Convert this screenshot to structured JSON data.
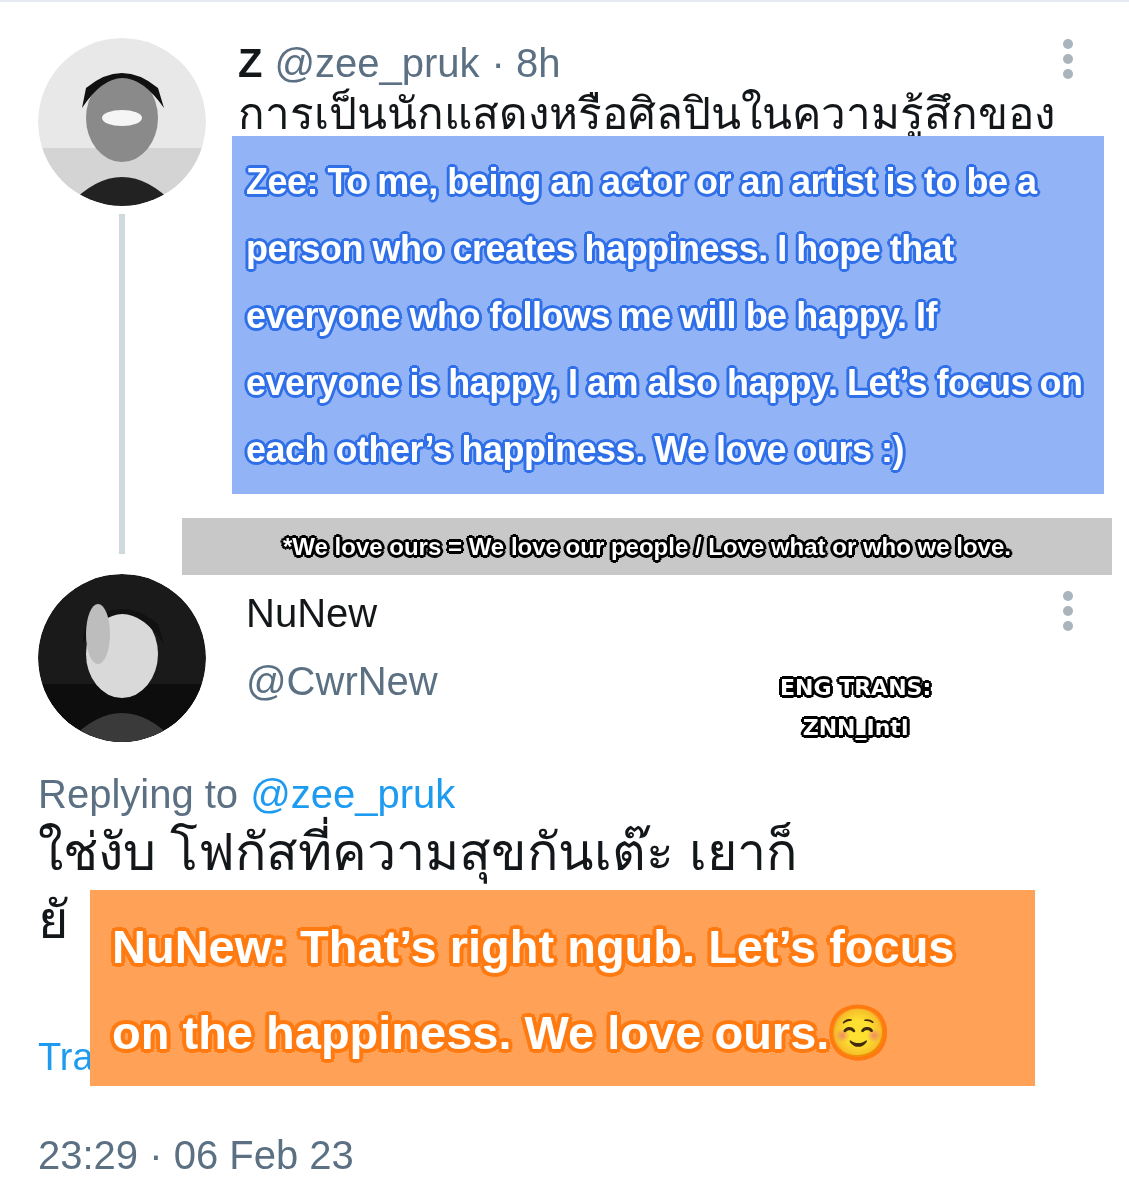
{
  "tweet": {
    "display_name": "Z",
    "handle": "@zee_pruk",
    "time": "· 8h",
    "text": "การเป็นนักแสดงหรือศิลปินในความรู้สึกของ"
  },
  "translation_overlay": {
    "text": "Zee: To me, being an actor or an artist is to be a person who creates happiness. I hope that everyone who follows me will be happy. If everyone is happy, I am also happy. Let’s focus on each other’s happiness. We love ours :)"
  },
  "note": "*We love ours = We love our people / Love what or who we love.",
  "reply": {
    "display_name": "NuNew",
    "handle": "@CwrNew",
    "replying_label": "Replying to",
    "replying_handle": "@zee_pruk",
    "text_lines": [
      "ใช่งับ โฟกัสที่ความสุขกันเต๊ะ เยาก็",
      "ยั"
    ],
    "translate_link": "Tra",
    "timestamp": "23:29 · 06 Feb 23"
  },
  "reply_translation": {
    "text": "NuNew: That’s right ngub. Let’s focus on the happiness. We love ours.☺️"
  },
  "credit": [
    "ENG TRANS:",
    "ZNN_Intl"
  ]
}
